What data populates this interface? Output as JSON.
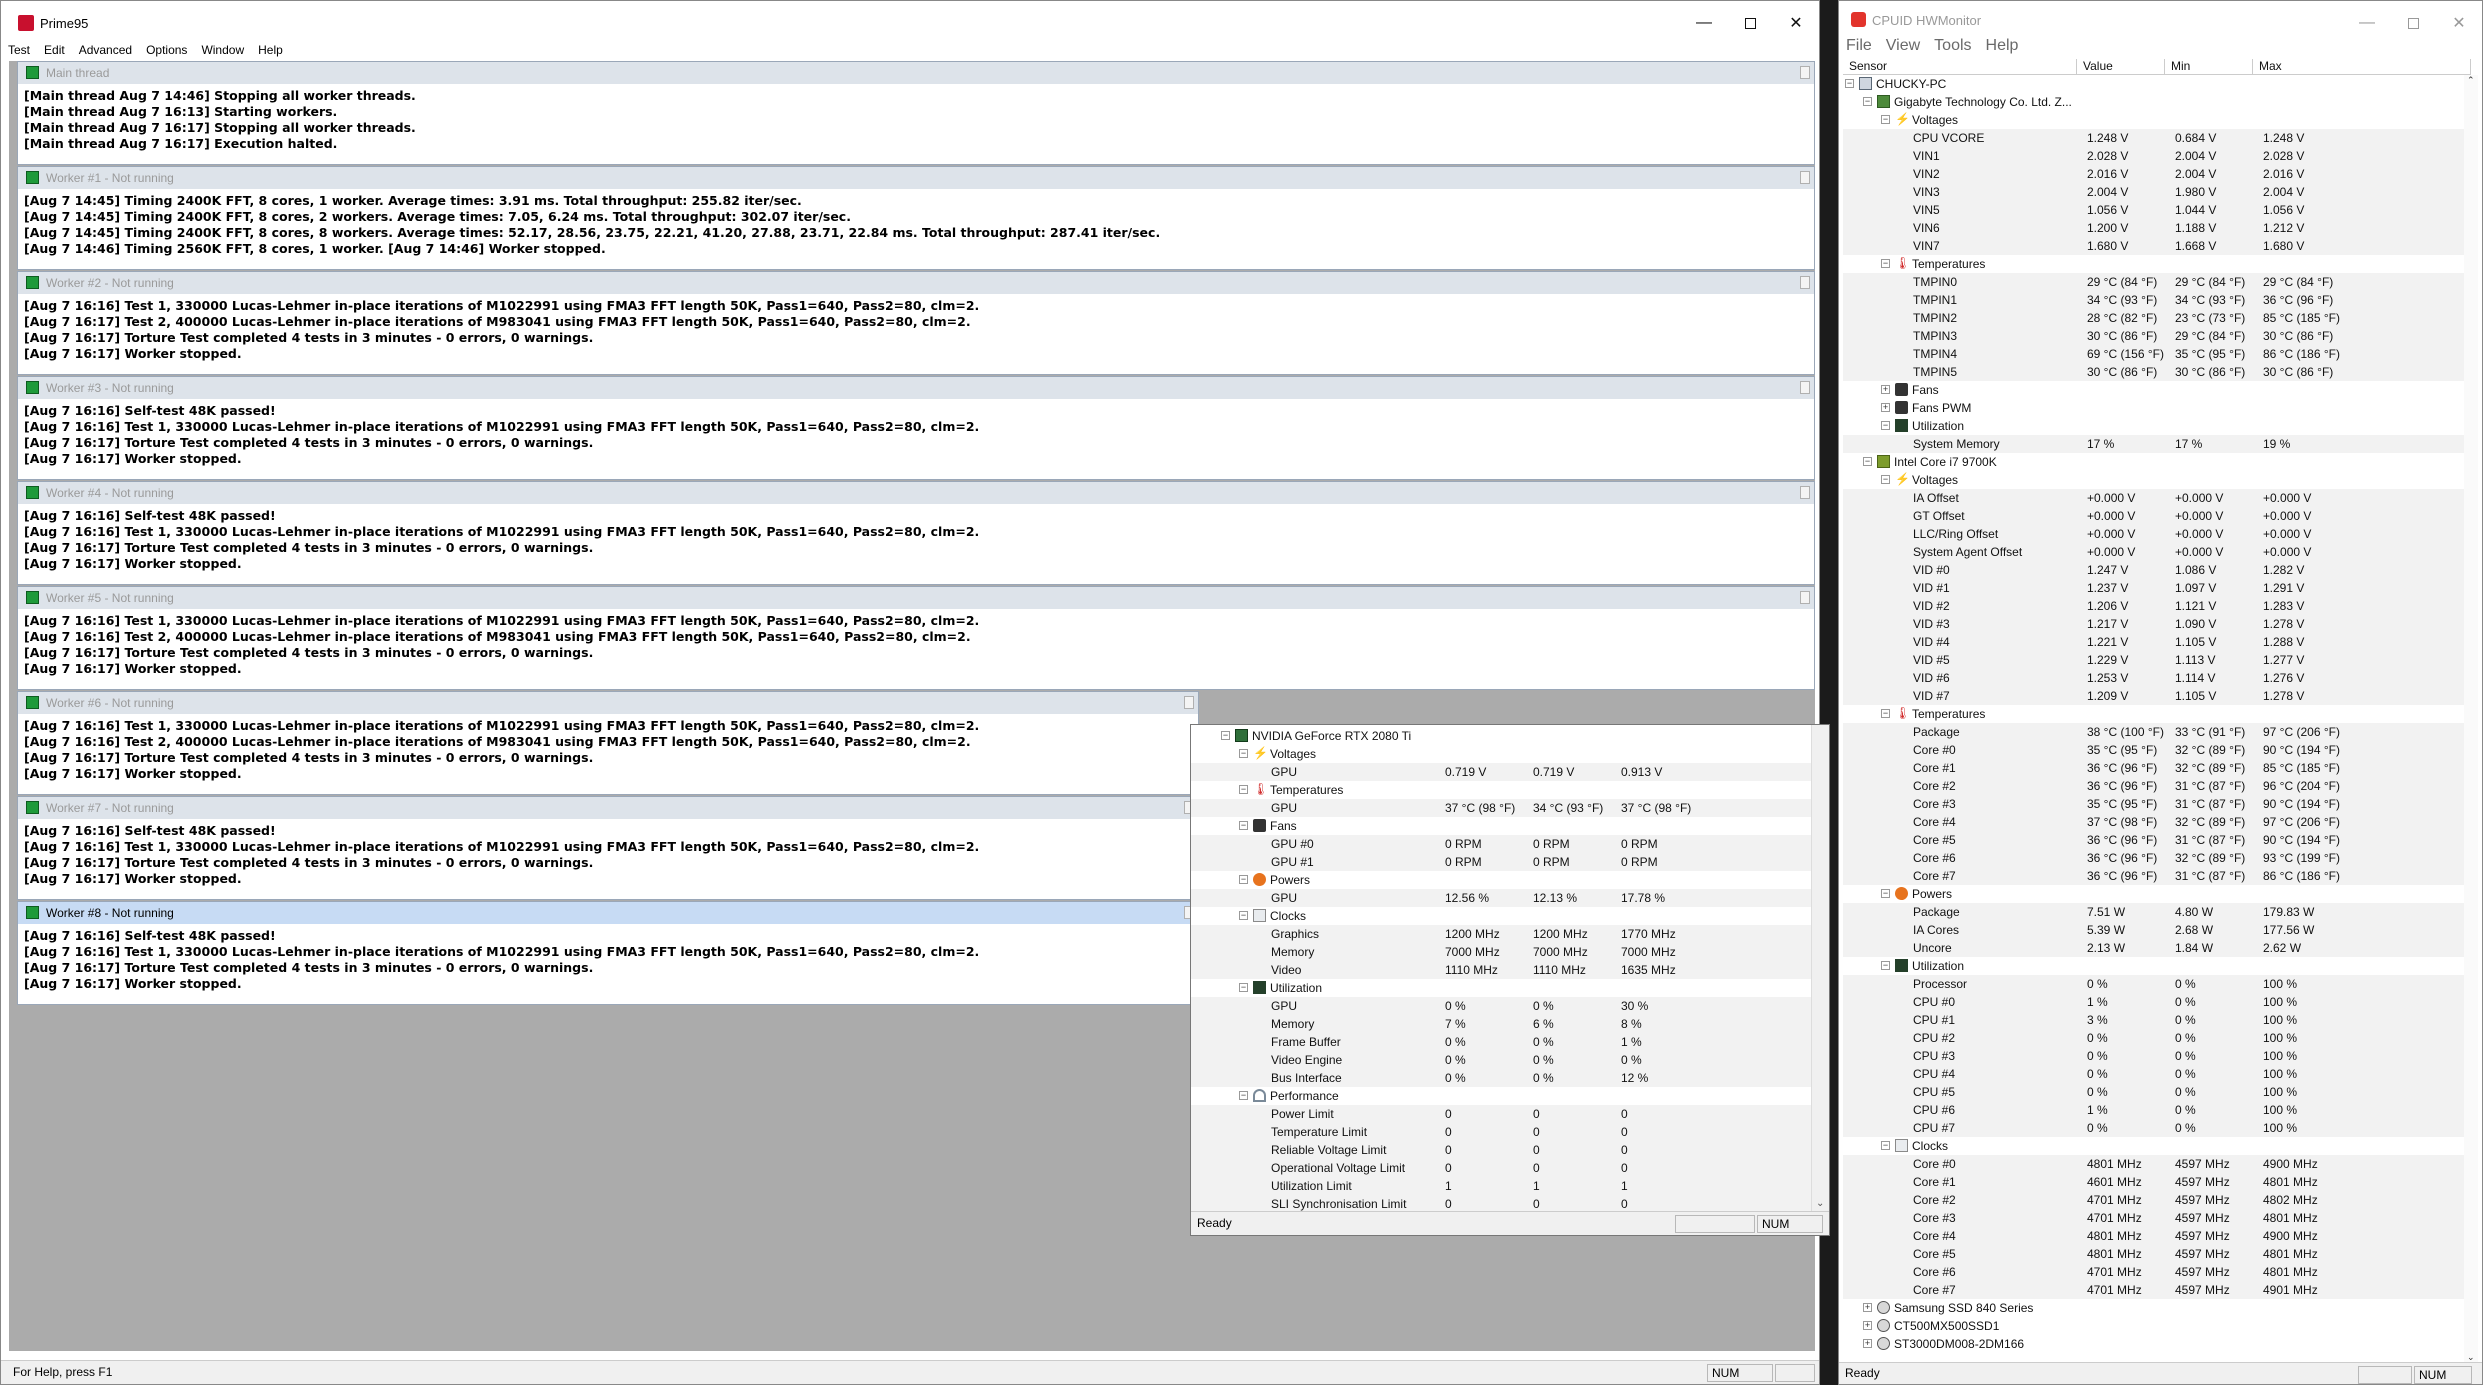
{
  "prime95": {
    "title": "Prime95",
    "menu": [
      "Test",
      "Edit",
      "Advanced",
      "Options",
      "Window",
      "Help"
    ],
    "status_left": "For Help, press F1",
    "status_num": "NUM",
    "windows": [
      {
        "title": "Main thread",
        "active": false,
        "lines": [
          "[Main thread Aug 7 14:46] Stopping all worker threads.",
          "[Main thread Aug 7 16:13] Starting workers.",
          "[Main thread Aug 7 16:17] Stopping all worker threads.",
          "[Main thread Aug 7 16:17] Execution halted."
        ]
      },
      {
        "title": "Worker #1 - Not running",
        "active": false,
        "lines": [
          "[Aug 7 14:45] Timing 2400K FFT, 8 cores, 1 worker.  Average times:  3.91 ms.  Total throughput: 255.82 iter/sec.",
          "[Aug 7 14:45] Timing 2400K FFT, 8 cores, 2 workers.  Average times:  7.05,  6.24 ms.  Total throughput: 302.07 iter/sec.",
          "[Aug 7 14:45] Timing 2400K FFT, 8 cores, 8 workers.  Average times: 52.17, 28.56, 23.75, 22.21, 41.20, 27.88, 23.71, 22.84 ms.  Total throughput: 287.41 iter/sec.",
          "[Aug 7 14:46] Timing 2560K FFT, 8 cores, 1 worker.  [Aug 7 14:46] Worker stopped."
        ]
      },
      {
        "title": "Worker #2 - Not running",
        "active": false,
        "lines": [
          "[Aug 7 16:16] Test 1, 330000 Lucas-Lehmer in-place iterations of M1022991 using FMA3 FFT length 50K, Pass1=640, Pass2=80, clm=2.",
          "[Aug 7 16:17] Test 2, 400000 Lucas-Lehmer in-place iterations of M983041 using FMA3 FFT length 50K, Pass1=640, Pass2=80, clm=2.",
          "[Aug 7 16:17] Torture Test completed 4 tests in 3 minutes - 0 errors, 0 warnings.",
          "[Aug 7 16:17] Worker stopped."
        ]
      },
      {
        "title": "Worker #3 - Not running",
        "active": false,
        "lines": [
          "[Aug 7 16:16] Self-test 48K passed!",
          "[Aug 7 16:16] Test 1, 330000 Lucas-Lehmer in-place iterations of M1022991 using FMA3 FFT length 50K, Pass1=640, Pass2=80, clm=2.",
          "[Aug 7 16:17] Torture Test completed 4 tests in 3 minutes - 0 errors, 0 warnings.",
          "[Aug 7 16:17] Worker stopped."
        ]
      },
      {
        "title": "Worker #4 - Not running",
        "active": false,
        "lines": [
          "[Aug 7 16:16] Self-test 48K passed!",
          "[Aug 7 16:16] Test 1, 330000 Lucas-Lehmer in-place iterations of M1022991 using FMA3 FFT length 50K, Pass1=640, Pass2=80, clm=2.",
          "[Aug 7 16:17] Torture Test completed 4 tests in 3 minutes - 0 errors, 0 warnings.",
          "[Aug 7 16:17] Worker stopped."
        ]
      },
      {
        "title": "Worker #5 - Not running",
        "active": false,
        "lines": [
          "[Aug 7 16:16] Test 1, 330000 Lucas-Lehmer in-place iterations of M1022991 using FMA3 FFT length 50K, Pass1=640, Pass2=80, clm=2.",
          "[Aug 7 16:16] Test 2, 400000 Lucas-Lehmer in-place iterations of M983041 using FMA3 FFT length 50K, Pass1=640, Pass2=80, clm=2.",
          "[Aug 7 16:17] Torture Test completed 4 tests in 3 minutes - 0 errors, 0 warnings.",
          "[Aug 7 16:17] Worker stopped."
        ]
      },
      {
        "title": "Worker #6 - Not running",
        "active": false,
        "lines": [
          "[Aug 7 16:16] Test 1, 330000 Lucas-Lehmer in-place iterations of M1022991 using FMA3 FFT length 50K, Pass1=640, Pass2=80, clm=2.",
          "[Aug 7 16:16] Test 2, 400000 Lucas-Lehmer in-place iterations of M983041 using FMA3 FFT length 50K, Pass1=640, Pass2=80, clm=2.",
          "[Aug 7 16:17] Torture Test completed 4 tests in 3 minutes - 0 errors, 0 warnings.",
          "[Aug 7 16:17] Worker stopped."
        ]
      },
      {
        "title": "Worker #7 - Not running",
        "active": false,
        "lines": [
          "[Aug 7 16:16] Self-test 48K passed!",
          "[Aug 7 16:16] Test 1, 330000 Lucas-Lehmer in-place iterations of M1022991 using FMA3 FFT length 50K, Pass1=640, Pass2=80, clm=2.",
          "[Aug 7 16:17] Torture Test completed 4 tests in 3 minutes - 0 errors, 0 warnings.",
          "[Aug 7 16:17] Worker stopped."
        ]
      },
      {
        "title": "Worker #8 - Not running",
        "active": true,
        "lines": [
          "[Aug 7 16:16] Self-test 48K passed!",
          "[Aug 7 16:16] Test 1, 330000 Lucas-Lehmer in-place iterations of M1022991 using FMA3 FFT length 50K, Pass1=640, Pass2=80, clm=2.",
          "[Aug 7 16:17] Torture Test completed 4 tests in 3 minutes - 0 errors, 0 warnings.",
          "[Aug 7 16:17] Worker stopped."
        ]
      }
    ]
  },
  "gpu_window": {
    "status_left": "Ready",
    "status_num": "NUM",
    "rows": [
      {
        "level": 0,
        "exp": "-",
        "icon": "ic-gpu",
        "name": "NVIDIA GeForce RTX 2080 Ti"
      },
      {
        "level": 1,
        "exp": "-",
        "icon": "ic-volt",
        "glyph": "⚡",
        "name": "Voltages"
      },
      {
        "level": 2,
        "name": "GPU",
        "value": "0.719 V",
        "min": "0.719 V",
        "max": "0.913 V"
      },
      {
        "level": 1,
        "exp": "-",
        "icon": "ic-temp",
        "glyph": "🌡",
        "name": "Temperatures"
      },
      {
        "level": 2,
        "name": "GPU",
        "value": "37 °C  (98 °F)",
        "min": "34 °C  (93 °F)",
        "max": "37 °C  (98 °F)"
      },
      {
        "level": 1,
        "exp": "-",
        "icon": "ic-fan",
        "name": "Fans"
      },
      {
        "level": 2,
        "name": "GPU #0",
        "value": "0 RPM",
        "min": "0 RPM",
        "max": "0 RPM"
      },
      {
        "level": 2,
        "name": "GPU #1",
        "value": "0 RPM",
        "min": "0 RPM",
        "max": "0 RPM"
      },
      {
        "level": 1,
        "exp": "-",
        "icon": "ic-pow",
        "name": "Powers"
      },
      {
        "level": 2,
        "name": "GPU",
        "value": "12.56 %",
        "min": "12.13 %",
        "max": "17.78 %"
      },
      {
        "level": 1,
        "exp": "-",
        "icon": "ic-clk",
        "name": "Clocks"
      },
      {
        "level": 2,
        "name": "Graphics",
        "value": "1200 MHz",
        "min": "1200 MHz",
        "max": "1770 MHz"
      },
      {
        "level": 2,
        "name": "Memory",
        "value": "7000 MHz",
        "min": "7000 MHz",
        "max": "7000 MHz"
      },
      {
        "level": 2,
        "name": "Video",
        "value": "1110 MHz",
        "min": "1110 MHz",
        "max": "1635 MHz"
      },
      {
        "level": 1,
        "exp": "-",
        "icon": "ic-util",
        "name": "Utilization"
      },
      {
        "level": 2,
        "name": "GPU",
        "value": "0 %",
        "min": "0 %",
        "max": "30 %"
      },
      {
        "level": 2,
        "name": "Memory",
        "value": "7 %",
        "min": "6 %",
        "max": "8 %"
      },
      {
        "level": 2,
        "name": "Frame Buffer",
        "value": "0 %",
        "min": "0 %",
        "max": "1 %"
      },
      {
        "level": 2,
        "name": "Video Engine",
        "value": "0 %",
        "min": "0 %",
        "max": "0 %"
      },
      {
        "level": 2,
        "name": "Bus Interface",
        "value": "0 %",
        "min": "0 %",
        "max": "12 %"
      },
      {
        "level": 1,
        "exp": "-",
        "icon": "ic-perf",
        "name": "Performance"
      },
      {
        "level": 2,
        "name": "Power Limit",
        "value": "0",
        "min": "0",
        "max": "0"
      },
      {
        "level": 2,
        "name": "Temperature Limit",
        "value": "0",
        "min": "0",
        "max": "0"
      },
      {
        "level": 2,
        "name": "Reliable Voltage Limit",
        "value": "0",
        "min": "0",
        "max": "0"
      },
      {
        "level": 2,
        "name": "Operational Voltage Limit",
        "value": "0",
        "min": "0",
        "max": "0"
      },
      {
        "level": 2,
        "name": "Utilization Limit",
        "value": "1",
        "min": "1",
        "max": "1"
      },
      {
        "level": 2,
        "name": "SLI Synchronisation Limit",
        "value": "0",
        "min": "0",
        "max": "0"
      }
    ]
  },
  "hwmonitor": {
    "title": "CPUID HWMonitor",
    "menu": [
      "File",
      "View",
      "Tools",
      "Help"
    ],
    "columns": [
      "Sensor",
      "Value",
      "Min",
      "Max"
    ],
    "status_left": "Ready",
    "status_num": "NUM",
    "rows": [
      {
        "level": 0,
        "exp": "-",
        "icon": "ic-pc",
        "name": "CHUCKY-PC"
      },
      {
        "level": 1,
        "exp": "-",
        "icon": "ic-board",
        "name": "Gigabyte Technology Co. Ltd. Z..."
      },
      {
        "level": 2,
        "exp": "-",
        "icon": "ic-volt",
        "glyph": "⚡",
        "name": "Voltages"
      },
      {
        "level": 3,
        "name": "CPU VCORE",
        "value": "1.248 V",
        "min": "0.684 V",
        "max": "1.248 V"
      },
      {
        "level": 3,
        "name": "VIN1",
        "value": "2.028 V",
        "min": "2.004 V",
        "max": "2.028 V"
      },
      {
        "level": 3,
        "name": "VIN2",
        "value": "2.016 V",
        "min": "2.004 V",
        "max": "2.016 V"
      },
      {
        "level": 3,
        "name": "VIN3",
        "value": "2.004 V",
        "min": "1.980 V",
        "max": "2.004 V"
      },
      {
        "level": 3,
        "name": "VIN5",
        "value": "1.056 V",
        "min": "1.044 V",
        "max": "1.056 V"
      },
      {
        "level": 3,
        "name": "VIN6",
        "value": "1.200 V",
        "min": "1.188 V",
        "max": "1.212 V"
      },
      {
        "level": 3,
        "name": "VIN7",
        "value": "1.680 V",
        "min": "1.668 V",
        "max": "1.680 V"
      },
      {
        "level": 2,
        "exp": "-",
        "icon": "ic-temp",
        "glyph": "🌡",
        "name": "Temperatures"
      },
      {
        "level": 3,
        "name": "TMPIN0",
        "value": "29 °C  (84 °F)",
        "min": "29 °C  (84 °F)",
        "max": "29 °C  (84 °F)"
      },
      {
        "level": 3,
        "name": "TMPIN1",
        "value": "34 °C  (93 °F)",
        "min": "34 °C  (93 °F)",
        "max": "36 °C  (96 °F)"
      },
      {
        "level": 3,
        "name": "TMPIN2",
        "value": "28 °C  (82 °F)",
        "min": "23 °C  (73 °F)",
        "max": "85 °C  (185 °F)"
      },
      {
        "level": 3,
        "name": "TMPIN3",
        "value": "30 °C  (86 °F)",
        "min": "29 °C  (84 °F)",
        "max": "30 °C  (86 °F)"
      },
      {
        "level": 3,
        "name": "TMPIN4",
        "value": "69 °C  (156 °F)",
        "min": "35 °C  (95 °F)",
        "max": "86 °C  (186 °F)"
      },
      {
        "level": 3,
        "name": "TMPIN5",
        "value": "30 °C  (86 °F)",
        "min": "30 °C  (86 °F)",
        "max": "30 °C  (86 °F)"
      },
      {
        "level": 2,
        "exp": "+",
        "icon": "ic-fan",
        "name": "Fans"
      },
      {
        "level": 2,
        "exp": "+",
        "icon": "ic-fan",
        "name": "Fans PWM"
      },
      {
        "level": 2,
        "exp": "-",
        "icon": "ic-util",
        "name": "Utilization"
      },
      {
        "level": 3,
        "name": "System Memory",
        "value": "17 %",
        "min": "17 %",
        "max": "19 %"
      },
      {
        "level": 1,
        "exp": "-",
        "icon": "ic-cpu",
        "name": "Intel Core i7 9700K"
      },
      {
        "level": 2,
        "exp": "-",
        "icon": "ic-volt",
        "glyph": "⚡",
        "name": "Voltages"
      },
      {
        "level": 3,
        "name": "IA Offset",
        "value": "+0.000 V",
        "min": "+0.000 V",
        "max": "+0.000 V"
      },
      {
        "level": 3,
        "name": "GT Offset",
        "value": "+0.000 V",
        "min": "+0.000 V",
        "max": "+0.000 V"
      },
      {
        "level": 3,
        "name": "LLC/Ring Offset",
        "value": "+0.000 V",
        "min": "+0.000 V",
        "max": "+0.000 V"
      },
      {
        "level": 3,
        "name": "System Agent Offset",
        "value": "+0.000 V",
        "min": "+0.000 V",
        "max": "+0.000 V"
      },
      {
        "level": 3,
        "name": "VID #0",
        "value": "1.247 V",
        "min": "1.086 V",
        "max": "1.282 V"
      },
      {
        "level": 3,
        "name": "VID #1",
        "value": "1.237 V",
        "min": "1.097 V",
        "max": "1.291 V"
      },
      {
        "level": 3,
        "name": "VID #2",
        "value": "1.206 V",
        "min": "1.121 V",
        "max": "1.283 V"
      },
      {
        "level": 3,
        "name": "VID #3",
        "value": "1.217 V",
        "min": "1.090 V",
        "max": "1.278 V"
      },
      {
        "level": 3,
        "name": "VID #4",
        "value": "1.221 V",
        "min": "1.105 V",
        "max": "1.288 V"
      },
      {
        "level": 3,
        "name": "VID #5",
        "value": "1.229 V",
        "min": "1.113 V",
        "max": "1.277 V"
      },
      {
        "level": 3,
        "name": "VID #6",
        "value": "1.253 V",
        "min": "1.114 V",
        "max": "1.276 V"
      },
      {
        "level": 3,
        "name": "VID #7",
        "value": "1.209 V",
        "min": "1.105 V",
        "max": "1.278 V"
      },
      {
        "level": 2,
        "exp": "-",
        "icon": "ic-temp",
        "glyph": "🌡",
        "name": "Temperatures"
      },
      {
        "level": 3,
        "name": "Package",
        "value": "38 °C  (100 °F)",
        "min": "33 °C  (91 °F)",
        "max": "97 °C  (206 °F)"
      },
      {
        "level": 3,
        "name": "Core #0",
        "value": "35 °C  (95 °F)",
        "min": "32 °C  (89 °F)",
        "max": "90 °C  (194 °F)"
      },
      {
        "level": 3,
        "name": "Core #1",
        "value": "36 °C  (96 °F)",
        "min": "32 °C  (89 °F)",
        "max": "85 °C  (185 °F)"
      },
      {
        "level": 3,
        "name": "Core #2",
        "value": "36 °C  (96 °F)",
        "min": "31 °C  (87 °F)",
        "max": "96 °C  (204 °F)"
      },
      {
        "level": 3,
        "name": "Core #3",
        "value": "35 °C  (95 °F)",
        "min": "31 °C  (87 °F)",
        "max": "90 °C  (194 °F)"
      },
      {
        "level": 3,
        "name": "Core #4",
        "value": "37 °C  (98 °F)",
        "min": "32 °C  (89 °F)",
        "max": "97 °C  (206 °F)"
      },
      {
        "level": 3,
        "name": "Core #5",
        "value": "36 °C  (96 °F)",
        "min": "31 °C  (87 °F)",
        "max": "90 °C  (194 °F)"
      },
      {
        "level": 3,
        "name": "Core #6",
        "value": "36 °C  (96 °F)",
        "min": "32 °C  (89 °F)",
        "max": "93 °C  (199 °F)"
      },
      {
        "level": 3,
        "name": "Core #7",
        "value": "36 °C  (96 °F)",
        "min": "31 °C  (87 °F)",
        "max": "86 °C  (186 °F)"
      },
      {
        "level": 2,
        "exp": "-",
        "icon": "ic-pow",
        "name": "Powers"
      },
      {
        "level": 3,
        "name": "Package",
        "value": "7.51 W",
        "min": "4.80 W",
        "max": "179.83 W"
      },
      {
        "level": 3,
        "name": "IA Cores",
        "value": "5.39 W",
        "min": "2.68 W",
        "max": "177.56 W"
      },
      {
        "level": 3,
        "name": "Uncore",
        "value": "2.13 W",
        "min": "1.84 W",
        "max": "2.62 W"
      },
      {
        "level": 2,
        "exp": "-",
        "icon": "ic-util",
        "name": "Utilization"
      },
      {
        "level": 3,
        "name": "Processor",
        "value": "0 %",
        "min": "0 %",
        "max": "100 %"
      },
      {
        "level": 3,
        "name": "CPU #0",
        "value": "1 %",
        "min": "0 %",
        "max": "100 %"
      },
      {
        "level": 3,
        "name": "CPU #1",
        "value": "3 %",
        "min": "0 %",
        "max": "100 %"
      },
      {
        "level": 3,
        "name": "CPU #2",
        "value": "0 %",
        "min": "0 %",
        "max": "100 %"
      },
      {
        "level": 3,
        "name": "CPU #3",
        "value": "0 %",
        "min": "0 %",
        "max": "100 %"
      },
      {
        "level": 3,
        "name": "CPU #4",
        "value": "0 %",
        "min": "0 %",
        "max": "100 %"
      },
      {
        "level": 3,
        "name": "CPU #5",
        "value": "0 %",
        "min": "0 %",
        "max": "100 %"
      },
      {
        "level": 3,
        "name": "CPU #6",
        "value": "1 %",
        "min": "0 %",
        "max": "100 %"
      },
      {
        "level": 3,
        "name": "CPU #7",
        "value": "0 %",
        "min": "0 %",
        "max": "100 %"
      },
      {
        "level": 2,
        "exp": "-",
        "icon": "ic-clk",
        "name": "Clocks"
      },
      {
        "level": 3,
        "name": "Core #0",
        "value": "4801 MHz",
        "min": "4597 MHz",
        "max": "4900 MHz"
      },
      {
        "level": 3,
        "name": "Core #1",
        "value": "4601 MHz",
        "min": "4597 MHz",
        "max": "4801 MHz"
      },
      {
        "level": 3,
        "name": "Core #2",
        "value": "4701 MHz",
        "min": "4597 MHz",
        "max": "4802 MHz"
      },
      {
        "level": 3,
        "name": "Core #3",
        "value": "4701 MHz",
        "min": "4597 MHz",
        "max": "4801 MHz"
      },
      {
        "level": 3,
        "name": "Core #4",
        "value": "4801 MHz",
        "min": "4597 MHz",
        "max": "4900 MHz"
      },
      {
        "level": 3,
        "name": "Core #5",
        "value": "4801 MHz",
        "min": "4597 MHz",
        "max": "4801 MHz"
      },
      {
        "level": 3,
        "name": "Core #6",
        "value": "4701 MHz",
        "min": "4597 MHz",
        "max": "4801 MHz"
      },
      {
        "level": 3,
        "name": "Core #7",
        "value": "4701 MHz",
        "min": "4597 MHz",
        "max": "4901 MHz"
      },
      {
        "level": 1,
        "exp": "+",
        "icon": "ic-disk",
        "name": "Samsung SSD 840 Series"
      },
      {
        "level": 1,
        "exp": "+",
        "icon": "ic-disk",
        "name": "CT500MX500SSD1"
      },
      {
        "level": 1,
        "exp": "+",
        "icon": "ic-disk",
        "name": "ST3000DM008-2DM166"
      }
    ]
  }
}
